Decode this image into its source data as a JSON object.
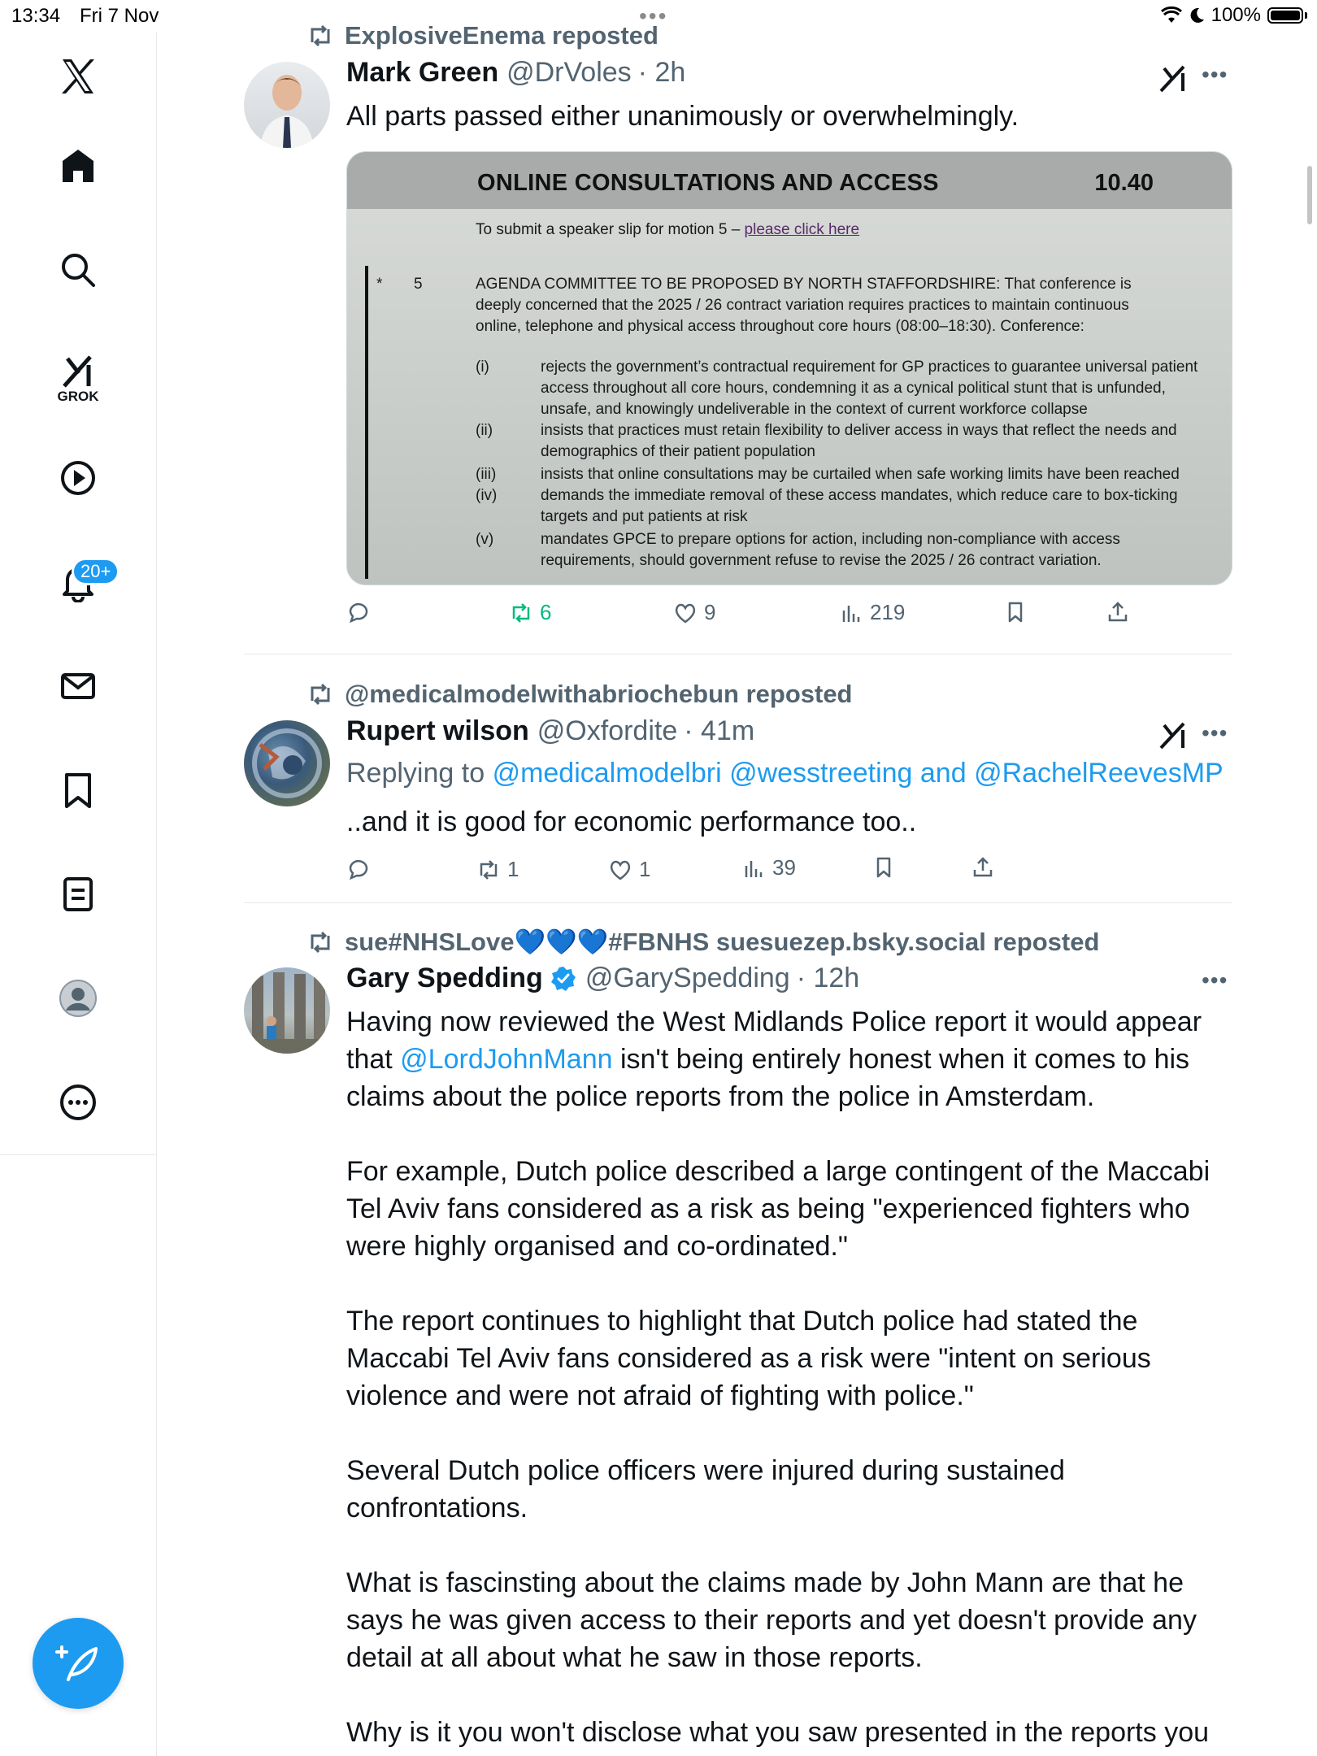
{
  "status_bar": {
    "time": "13:34",
    "date": "Fri 7 Nov",
    "battery": "100%"
  },
  "sidebar": {
    "grok_label": "GROK",
    "notifications_badge": "20+"
  },
  "posts": [
    {
      "repost_by": "ExplosiveEnema reposted",
      "name": "Mark Green",
      "handle": "@DrVoles",
      "time": "· 2h",
      "text": "All parts passed either unanimously or overwhelmingly.",
      "image": {
        "title": "ONLINE CONSULTATIONS AND ACCESS",
        "time": "10.40",
        "speaker_slip": "To submit a speaker slip for motion 5 –",
        "speaker_link": "please click here",
        "star": "*",
        "motion_number": "5",
        "motion_text": "AGENDA COMMITTEE TO BE PROPOSED BY NORTH STAFFORDSHIRE: That conference is deeply concerned that the 2025 / 26 contract variation requires practices to maintain continuous online, telephone and physical access throughout core hours (08:00–18:30). Conference:",
        "items": [
          {
            "num": "(i)",
            "text": "rejects the government’s contractual requirement for GP practices to guarantee universal patient access throughout all core hours, condemning it as a cynical political stunt that is unfunded, unsafe, and knowingly undeliverable in the context of current workforce collapse"
          },
          {
            "num": "(ii)",
            "text": "insists that practices must retain flexibility to deliver access in ways that reflect the needs and demographics of their patient population"
          },
          {
            "num": "(iii)",
            "text": "insists that online consultations may be curtailed when safe working limits have been reached"
          },
          {
            "num": "(iv)",
            "text": "demands the immediate removal of these access mandates, which reduce care to box-ticking targets and put patients at risk"
          },
          {
            "num": "(v)",
            "text": "mandates GPCE to prepare options for action, including non-compliance with access requirements, should government refuse to revise the 2025 / 26 contract variation."
          }
        ]
      },
      "replies": "",
      "reposts": "6",
      "likes": "9",
      "views": "219"
    },
    {
      "repost_by": "@medicalmodelwithabriochebun reposted",
      "name": "Rupert wilson",
      "handle": "@Oxfordite",
      "time": "· 41m",
      "replying_prefix": "Replying to",
      "replying_to": "@medicalmodelbri @wesstreeting and @RachelReevesMP",
      "text": "..and it is good for economic performance too..",
      "replies": "",
      "reposts": "1",
      "likes": "1",
      "views": "39"
    },
    {
      "repost_by": "sue#NHSLove💙💙💙#FBNHS suesuezep.bsky.social reposted",
      "name": "Gary Spedding",
      "handle": "@GarySpedding",
      "time": "· 12h",
      "text_before_mention": "Having now reviewed the West Midlands Police report it would appear that ",
      "mention": "@LordJohnMann",
      "text_after_mention": " isn't being entirely honest when it comes to his claims about the police reports from the police in Amsterdam.",
      "paragraphs": [
        "For example, Dutch police described a large contingent of the Maccabi Tel Aviv fans considered as a risk as being \"experienced fighters who were highly organised and co-ordinated.\"",
        "The report continues to highlight that Dutch police had stated the Maccabi Tel Aviv fans considered as a risk were \"intent on serious violence and were not afraid of fighting with police.\"",
        "Several Dutch police officers were injured during sustained confrontations.",
        "What is fascinsting about the claims made by John Mann are that he says he was given access to their reports and yet doesn't provide any detail at all about what he saw in those reports.",
        "Why is it you won't disclose what you saw presented in the reports you"
      ]
    }
  ],
  "colors": {
    "accent": "#1d9bf0",
    "repost_active": "#00ba7c",
    "muted": "#536471"
  }
}
